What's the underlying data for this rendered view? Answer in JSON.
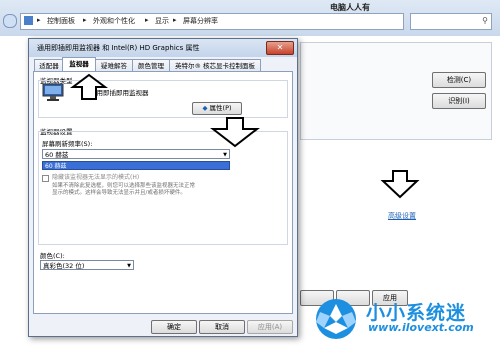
{
  "background_window": {
    "breadcrumbs": [
      "控制面板",
      "外观和个性化",
      "显示",
      "屏幕分辨率"
    ],
    "separator": "▸",
    "brand": "电脑人人有",
    "detect_label": "检测(C)",
    "identify_label": "识别(I)",
    "advanced_link": "高级设置",
    "apply_label": "应用"
  },
  "dialog": {
    "title": "通用即插即用监视器 和 Intel(R) HD Graphics 属性",
    "close_label": "✕",
    "tabs": [
      "适配器",
      "监视器",
      "疑难解答",
      "颜色管理",
      "英特尔® 核芯显卡控制面板"
    ],
    "active_tab": 1,
    "monitor_type_label": "监视器类型",
    "monitor_name": "通用即插即用监视器",
    "properties_button": "属性(P)",
    "monitor_settings_label": "监视器设置",
    "refresh_rate_label": "屏幕刷新频率(S):",
    "refresh_rate_value": "60 赫兹",
    "dropdown_option": "60 赫兹",
    "hide_modes_label": "隐藏该监视器无法显示的模式(H)",
    "hide_modes_desc_1": "如果不清除此复选框，则您可以选择那些该监视器无法正常",
    "hide_modes_desc_2": "显示的模式。这样会导致无法显示并且/或者损坏硬件。",
    "colors_label": "颜色(C):",
    "colors_value": "真彩色(32 位)",
    "ok_label": "确定",
    "cancel_label": "取消",
    "apply_label": "应用(A)"
  },
  "watermark": {
    "title": "小小系统迷",
    "url": "www.ilovext.com"
  },
  "colors": {
    "accent_blue": "#1d8fe0",
    "selection_blue": "#3a6fd8",
    "close_red": "#c7432c"
  },
  "icons": {
    "monitor": "monitor-icon",
    "shield": "shield-icon",
    "arrow": "arrow-icon"
  }
}
